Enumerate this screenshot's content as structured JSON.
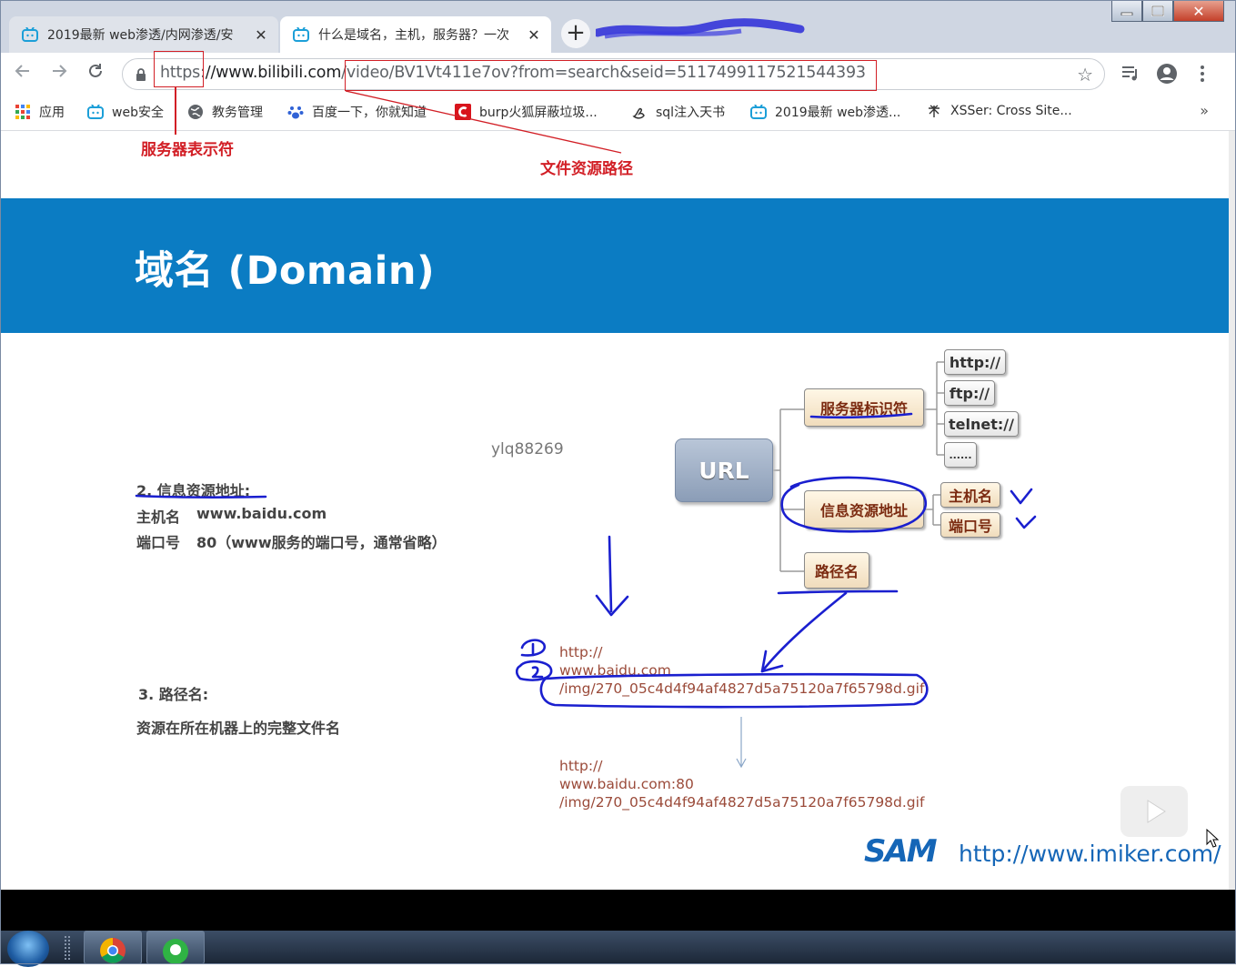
{
  "browser": {
    "tabs": [
      {
        "title": "2019最新 web渗透/内网渗透/安",
        "active": false
      },
      {
        "title": "什么是域名，主机，服务器？一次",
        "active": true
      }
    ],
    "new_tab_label": "+",
    "close_glyph": "✕",
    "url_scheme": "https:",
    "url_host": "//www.bilibili.com",
    "url_path": "/video/BV1Vt411e7ov?from=search&seid=5117499117521544393",
    "bookmarks": [
      {
        "label": "应用",
        "icon": "apps-grid-icon"
      },
      {
        "label": "web安全",
        "icon": "bilibili-icon"
      },
      {
        "label": "教务管理",
        "icon": "globe-icon"
      },
      {
        "label": "百度一下，你就知道",
        "icon": "baidu-paw-icon"
      },
      {
        "label": "burp火狐屏蔽垃圾...",
        "icon": "csdn-c-icon"
      },
      {
        "label": "sql注入天书",
        "icon": "hand-icon"
      },
      {
        "label": "2019最新 web渗透...",
        "icon": "bilibili-icon"
      },
      {
        "label": "XSSer: Cross Site...",
        "icon": "mosquito-icon"
      }
    ],
    "bookmarks_more": "»"
  },
  "annotations": {
    "server_identifier": "服务器表示符",
    "file_resource_path": "文件资源路径"
  },
  "slide": {
    "title": "域名 (Domain)",
    "watermark": "ylq88269",
    "section2_heading": "2. 信息资源地址:",
    "section2_host_label": "主机名",
    "section2_host_value": "www.baidu.com",
    "section2_port_label": "端口号",
    "section2_port_value": "80（www服务的端口号，通常省略）",
    "section3_heading": "3. 路径名:",
    "section3_desc": "资源在所在机器上的完整文件名",
    "mindmap": {
      "root": "URL",
      "server_id": "服务器标识符",
      "info_addr": "信息资源地址",
      "path_name": "路径名",
      "protocols": [
        "http://",
        "ftp://",
        "telnet://",
        "......"
      ],
      "info_children": [
        "主机名",
        "端口号"
      ]
    },
    "example1": [
      "http://",
      "www.baidu.com",
      "/img/270_05c4d4f94af4827d5a75120a7f65798d.gif"
    ],
    "example2": [
      "http://",
      "www.baidu.com:80",
      "/img/270_05c4d4f94af4827d5a75120a7f65798d.gif"
    ],
    "logo": "SAM",
    "site": "http://www.imiker.com/",
    "handwritten_marks": [
      "1",
      "2"
    ]
  },
  "colors": {
    "band_blue": "#0b7cc3",
    "annotation_red": "#d21f26",
    "ink_blue": "#1a1fcf",
    "brand_blue": "#1566b7"
  }
}
